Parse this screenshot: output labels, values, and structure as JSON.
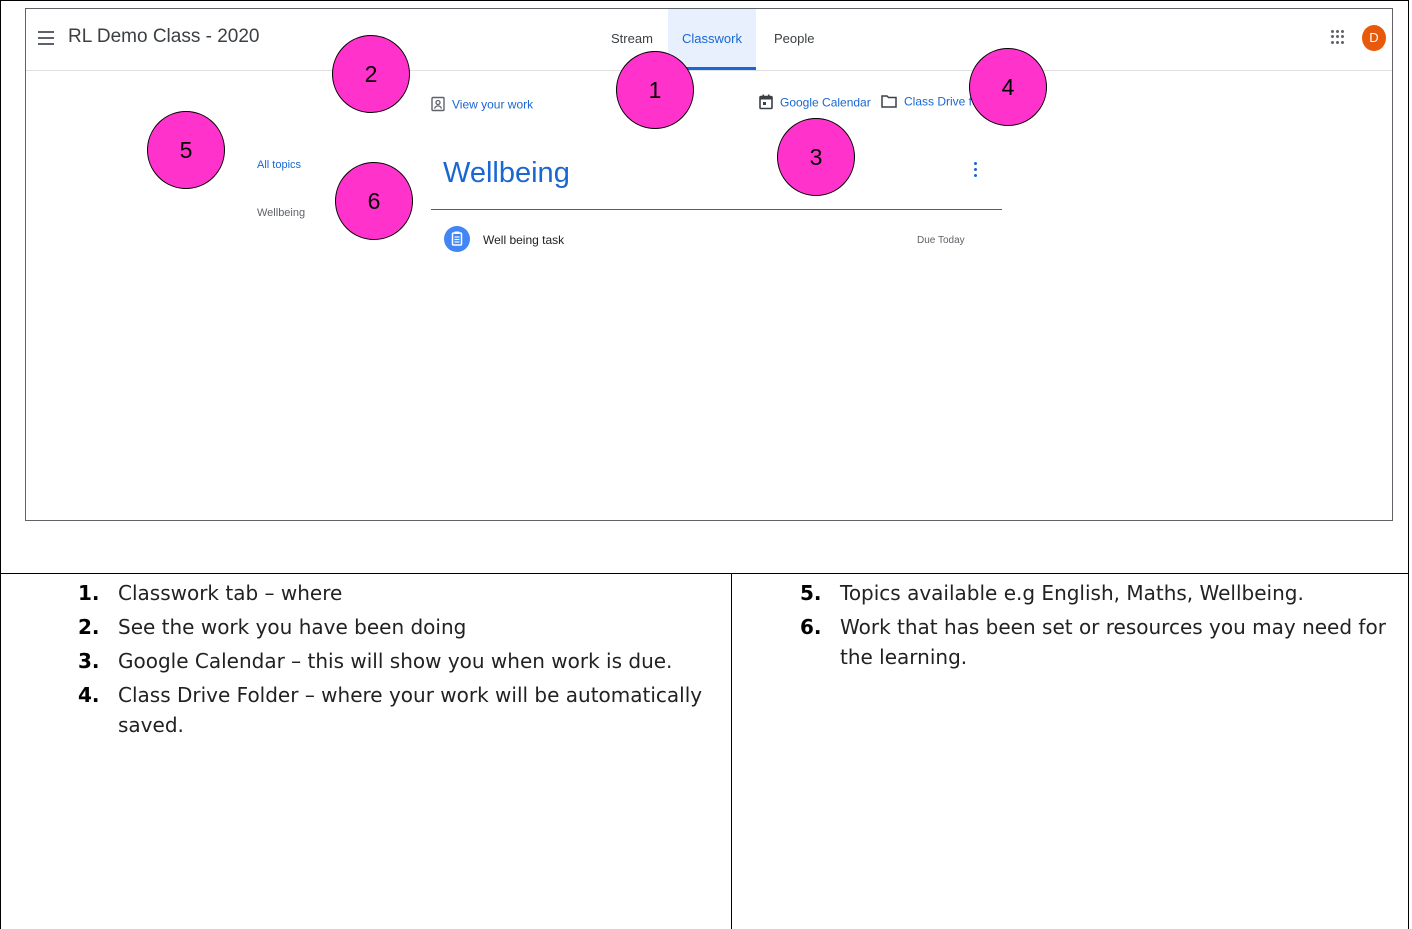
{
  "header": {
    "class_title": "RL Demo Class - 2020",
    "avatar_letter": "D"
  },
  "tabs": [
    {
      "label": "Stream",
      "active": false
    },
    {
      "label": "Classwork",
      "active": true
    },
    {
      "label": "People",
      "active": false
    }
  ],
  "links": {
    "view_your_work": "View your work",
    "google_calendar": "Google Calendar",
    "class_drive_folder": "Class Drive folder"
  },
  "topics": [
    {
      "label": "All topics",
      "selected": true
    },
    {
      "label": "Wellbeing",
      "selected": false
    }
  ],
  "section": {
    "title": "Wellbeing",
    "items": [
      {
        "title": "Well being task",
        "due": "Due Today"
      }
    ]
  },
  "callouts": [
    "1",
    "2",
    "3",
    "4",
    "5",
    "6"
  ],
  "notes_left": [
    {
      "num": "1.",
      "text": "Classwork tab – where"
    },
    {
      "num": "2.",
      "text": "See the work you have been doing"
    },
    {
      "num": "3.",
      "text": "Google Calendar – this will show you when work is due."
    },
    {
      "num": "4.",
      "text": "Class Drive Folder – where your work will be automatically saved."
    }
  ],
  "notes_right": [
    {
      "num": "5.",
      "text": "Topics available e.g English, Maths, Wellbeing."
    },
    {
      "num": "6.",
      "text": "Work that has been set or resources you may need for the learning."
    }
  ],
  "colors": {
    "accent": "#1967d2",
    "callout": "#ff33cc",
    "avatar": "#e8590c",
    "assignment_icon": "#4285f4"
  }
}
